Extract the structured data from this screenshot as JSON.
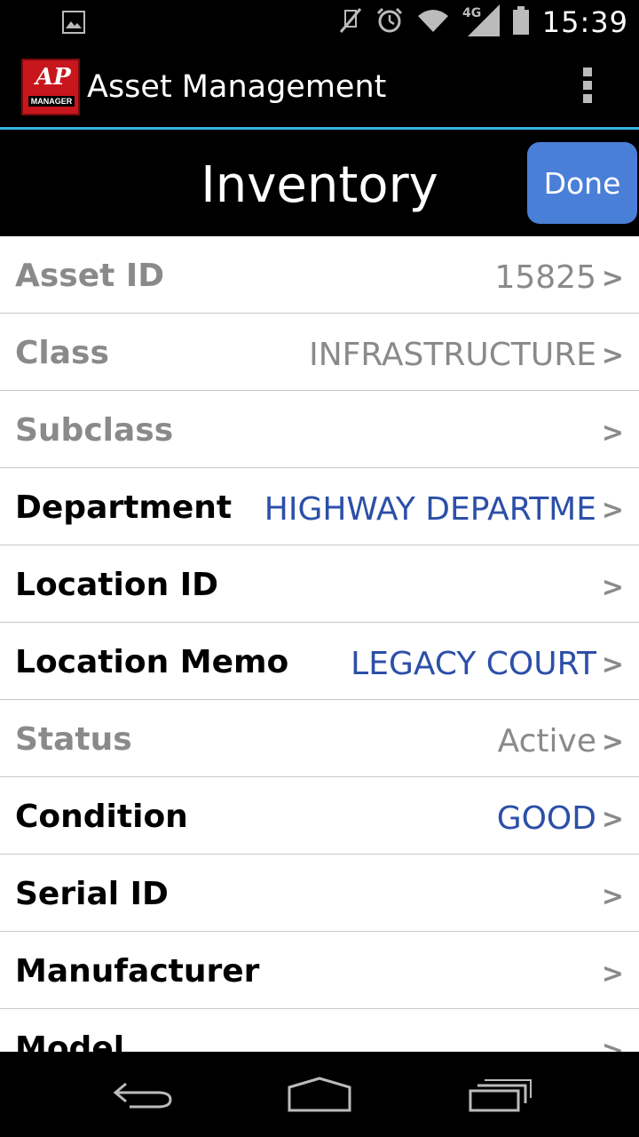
{
  "status_bar": {
    "time": "15:39",
    "network": "4G",
    "icons": [
      "image-icon",
      "mute-icon",
      "alarm-icon",
      "wifi-icon",
      "signal-icon",
      "battery-icon"
    ]
  },
  "action_bar": {
    "logo_mark": "AP",
    "logo_text": "MANAGER",
    "title": "Asset Management"
  },
  "header": {
    "title": "Inventory",
    "done_label": "Done"
  },
  "colors": {
    "accent_divider": "#33b5e5",
    "done_button": "#4a7fd8",
    "value_blue": "#2c4fa8",
    "muted_gray": "#8a8a8a",
    "logo_red": "#c8161d"
  },
  "fields": [
    {
      "label": "Asset ID",
      "value": "15825",
      "editable": false,
      "value_style": "gray"
    },
    {
      "label": "Class",
      "value": "INFRASTRUCTURE",
      "editable": false,
      "value_style": "gray"
    },
    {
      "label": "Subclass",
      "value": "",
      "editable": false,
      "value_style": "gray"
    },
    {
      "label": "Department",
      "value": "HIGHWAY DEPARTME",
      "editable": true,
      "value_style": "blue"
    },
    {
      "label": "Location ID",
      "value": "",
      "editable": true,
      "value_style": "blue"
    },
    {
      "label": "Location Memo",
      "value": "LEGACY COURT",
      "editable": true,
      "value_style": "blue"
    },
    {
      "label": "Status",
      "value": "Active",
      "editable": false,
      "value_style": "gray"
    },
    {
      "label": "Condition",
      "value": "GOOD",
      "editable": true,
      "value_style": "blue"
    },
    {
      "label": "Serial ID",
      "value": "",
      "editable": true,
      "value_style": "blue"
    },
    {
      "label": "Manufacturer",
      "value": "",
      "editable": true,
      "value_style": "blue"
    },
    {
      "label": "Model",
      "value": "",
      "editable": true,
      "value_style": "blue"
    }
  ],
  "chevron": ">",
  "nav_bar": {
    "buttons": [
      "back-icon",
      "home-icon",
      "recent-apps-icon"
    ]
  }
}
